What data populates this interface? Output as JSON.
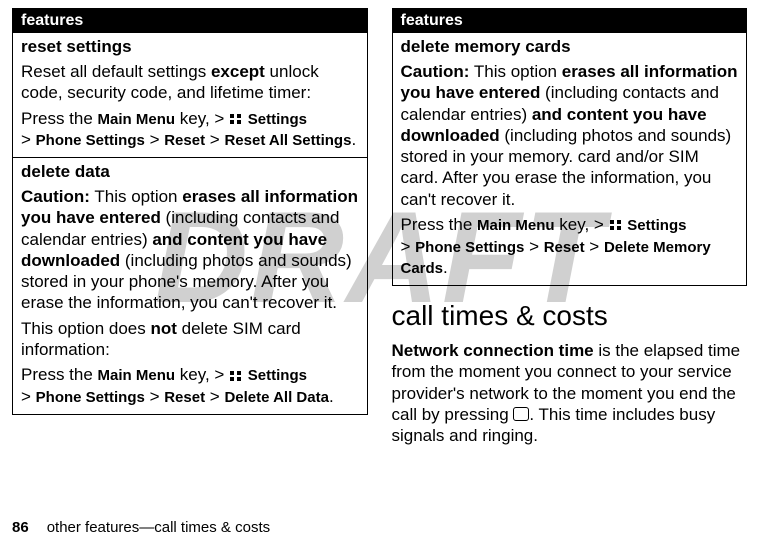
{
  "watermark": "DRAFT",
  "left": {
    "header": "features",
    "reset": {
      "title": "reset settings",
      "p1_a": "Reset all default settings ",
      "p1_b": "except",
      "p1_c": " unlock code, security code, and lifetime timer:",
      "p2_a": "Press the ",
      "p2_b": "Main Menu",
      "p2_c": " key, > ",
      "nav1": "Settings",
      "nav2": "Phone Settings",
      "nav3": "Reset",
      "nav4": "Reset All Settings"
    },
    "deleteData": {
      "title": "delete data",
      "p1_a": "Caution:",
      "p1_b": " This option ",
      "p1_c": "erases all information you have entered",
      "p1_d": " (including contacts and calendar entries) ",
      "p1_e": "and content you have downloaded",
      "p1_f": " (including photos and sounds) stored in your phone's memory. After you erase the information, you can't recover it.",
      "p2_a": "This option does ",
      "p2_b": "not",
      "p2_c": " delete SIM card information:",
      "p3_a": "Press the ",
      "p3_b": "Main Menu",
      "p3_c": " key, > ",
      "nav1": "Settings",
      "nav2": "Phone Settings",
      "nav3": "Reset",
      "nav4": "Delete All Data"
    }
  },
  "right": {
    "header": "features",
    "deleteMem": {
      "title": "delete memory cards",
      "p1_a": "Caution:",
      "p1_b": " This option ",
      "p1_c": "erases all information you have entered",
      "p1_d": " (including contacts and calendar entries) ",
      "p1_e": "and content you have downloaded",
      "p1_f": " (including photos and sounds) stored in your memory. card and/or SIM card. After you erase the information, you can't recover it.",
      "p2_a": "Press the ",
      "p2_b": "Main Menu",
      "p2_c": " key, > ",
      "nav1": "Settings",
      "nav2": "Phone Settings",
      "nav3": "Reset",
      "nav4": "Delete Memory Cards"
    },
    "heading": "call times & costs",
    "body_a": "Network connection time",
    "body_b": " is the elapsed time from the moment you connect to your service provider's network to the moment you end the call by pressing ",
    "body_c": ". This time includes busy signals and ringing."
  },
  "footer": {
    "page": "86",
    "text": "other features—call times & costs"
  },
  "sep": " > ",
  "period": "."
}
